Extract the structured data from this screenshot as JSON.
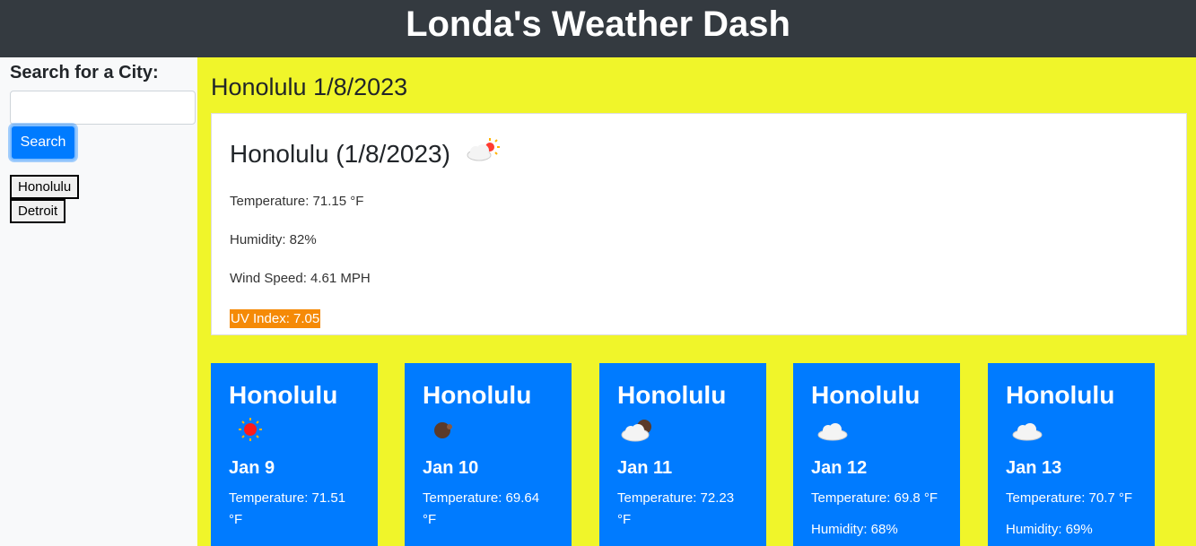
{
  "header": {
    "title": "Londa's Weather Dash"
  },
  "sidebar": {
    "label": "Search for a City:",
    "search_placeholder": "",
    "search_button": "Search",
    "history": [
      {
        "label": "Honolulu"
      },
      {
        "label": "Detroit"
      }
    ]
  },
  "main": {
    "heading": "Honolulu 1/8/2023",
    "current": {
      "title": "Honolulu (1/8/2023)",
      "icon": "partly-sunny",
      "temperature": "Temperature: 71.15 °F",
      "humidity": "Humidity: 82%",
      "wind": "Wind Speed: 4.61 MPH",
      "uv": "UV Index: 7.05",
      "uv_color": "#f58a07"
    },
    "forecast": [
      {
        "city": "Honolulu",
        "icon": "sun",
        "date": "Jan 9",
        "temp": "Temperature: 71.51 °F",
        "humidity": ""
      },
      {
        "city": "Honolulu",
        "icon": "moon",
        "date": "Jan 10",
        "temp": "Temperature: 69.64 °F",
        "humidity": ""
      },
      {
        "city": "Honolulu",
        "icon": "cloud-moon",
        "date": "Jan 11",
        "temp": "Temperature: 72.23 °F",
        "humidity": ""
      },
      {
        "city": "Honolulu",
        "icon": "cloud",
        "date": "Jan 12",
        "temp": "Temperature: 69.8 °F",
        "humidity": "Humidity: 68%"
      },
      {
        "city": "Honolulu",
        "icon": "cloud",
        "date": "Jan 13",
        "temp": "Temperature: 70.7 °F",
        "humidity": "Humidity: 69%"
      }
    ]
  },
  "colors": {
    "header_bg": "#343a40",
    "main_bg": "#f0f52a",
    "card_bg": "#007bff",
    "accent": "#007bff"
  }
}
